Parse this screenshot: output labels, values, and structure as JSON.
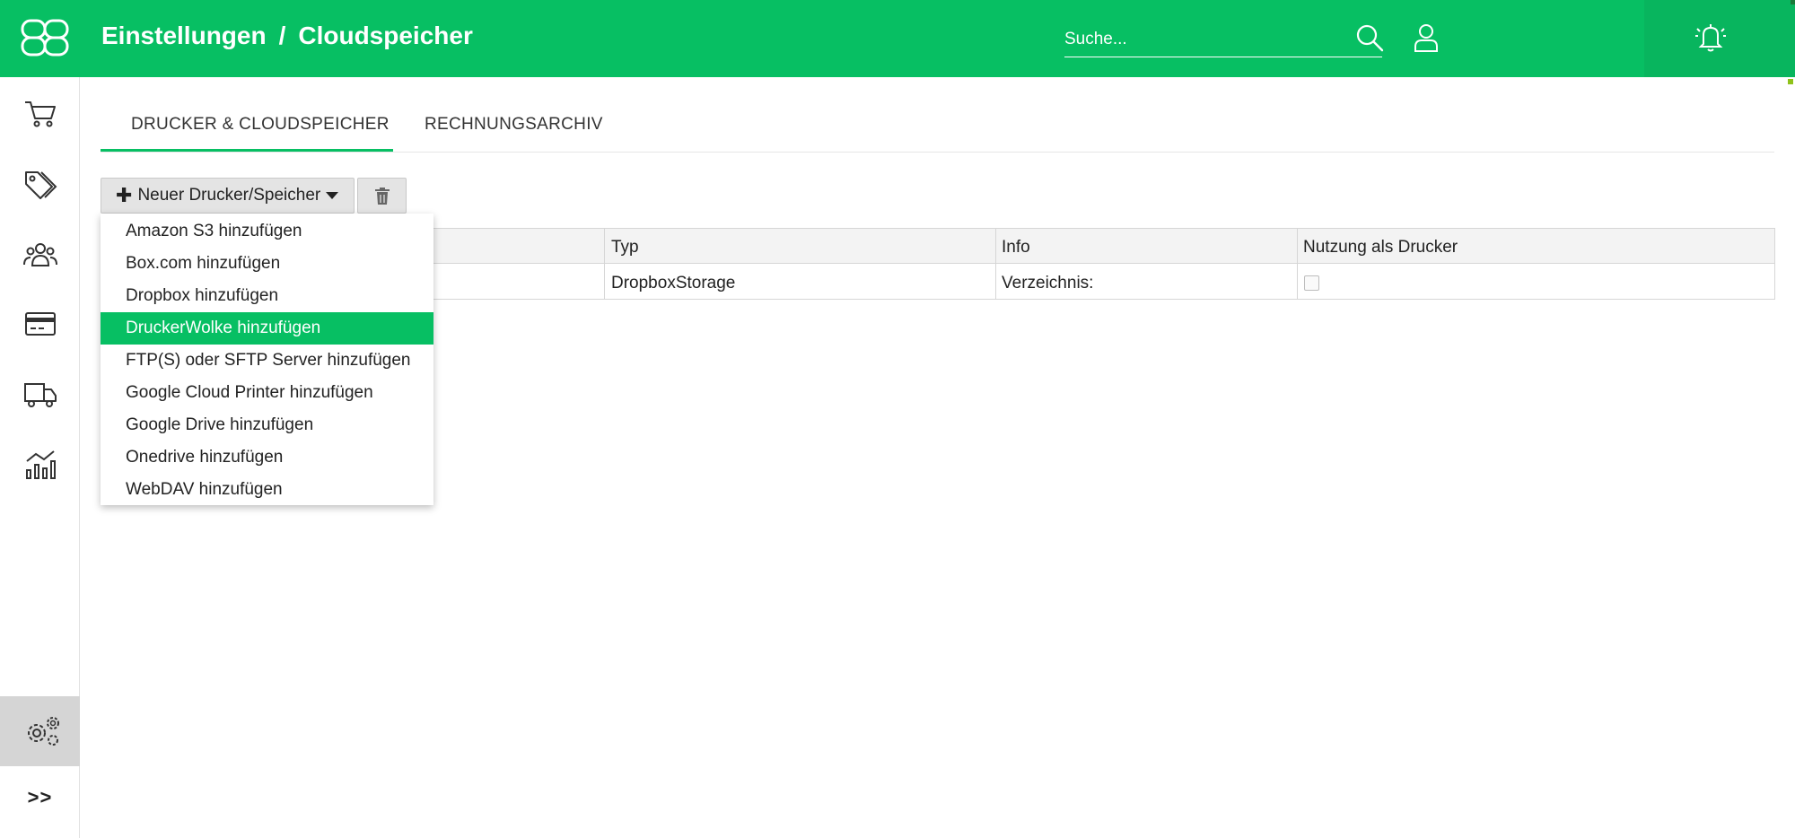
{
  "header": {
    "breadcrumb": [
      "Einstellungen",
      "/",
      "Cloudspeicher"
    ],
    "search_placeholder": "Suche..."
  },
  "tabs": [
    {
      "label": "DRUCKER & CLOUDSPEICHER",
      "active": true
    },
    {
      "label": "RECHNUNGSARCHIV",
      "active": false
    }
  ],
  "toolbar": {
    "new_label": "Neuer Drucker/Speicher"
  },
  "dropdown": {
    "items": [
      "Amazon S3 hinzufügen",
      "Box.com hinzufügen",
      "Dropbox hinzufügen",
      "DruckerWolke hinzufügen",
      "FTP(S) oder SFTP Server hinzufügen",
      "Google Cloud Printer hinzufügen",
      "Google Drive hinzufügen",
      "Onedrive hinzufügen",
      "WebDAV hinzufügen"
    ],
    "highlighted": "DruckerWolke hinzufügen"
  },
  "table": {
    "columns": [
      "Typ",
      "Info",
      "Nutzung als Drucker"
    ],
    "rows": [
      {
        "typ": "DropboxStorage",
        "info": "Verzeichnis:",
        "printer_use": false
      }
    ]
  },
  "sidebar": {
    "items": [
      "cart-icon",
      "tags-icon",
      "customers-icon",
      "payment-card-icon",
      "delivery-truck-icon",
      "analytics-icon",
      "settings-gears-icon"
    ],
    "expand_label": ">>"
  },
  "colors": {
    "brand_green": "#07bf63",
    "active_sidebar": "#d5d5d5"
  }
}
